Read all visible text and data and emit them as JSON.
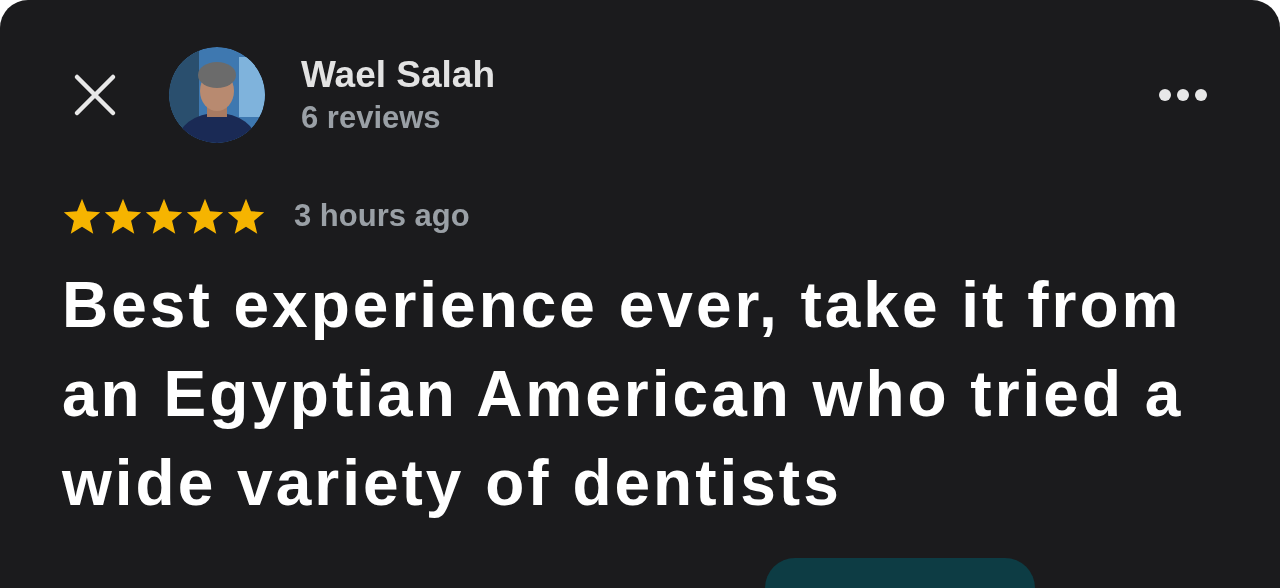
{
  "reviewer": {
    "name": "Wael Salah",
    "reviews": "6 reviews"
  },
  "review": {
    "stars": 5,
    "time": "3 hours ago",
    "text": "Best experience ever, take it from an Egyptian American who tried a wide variety of dentists"
  }
}
